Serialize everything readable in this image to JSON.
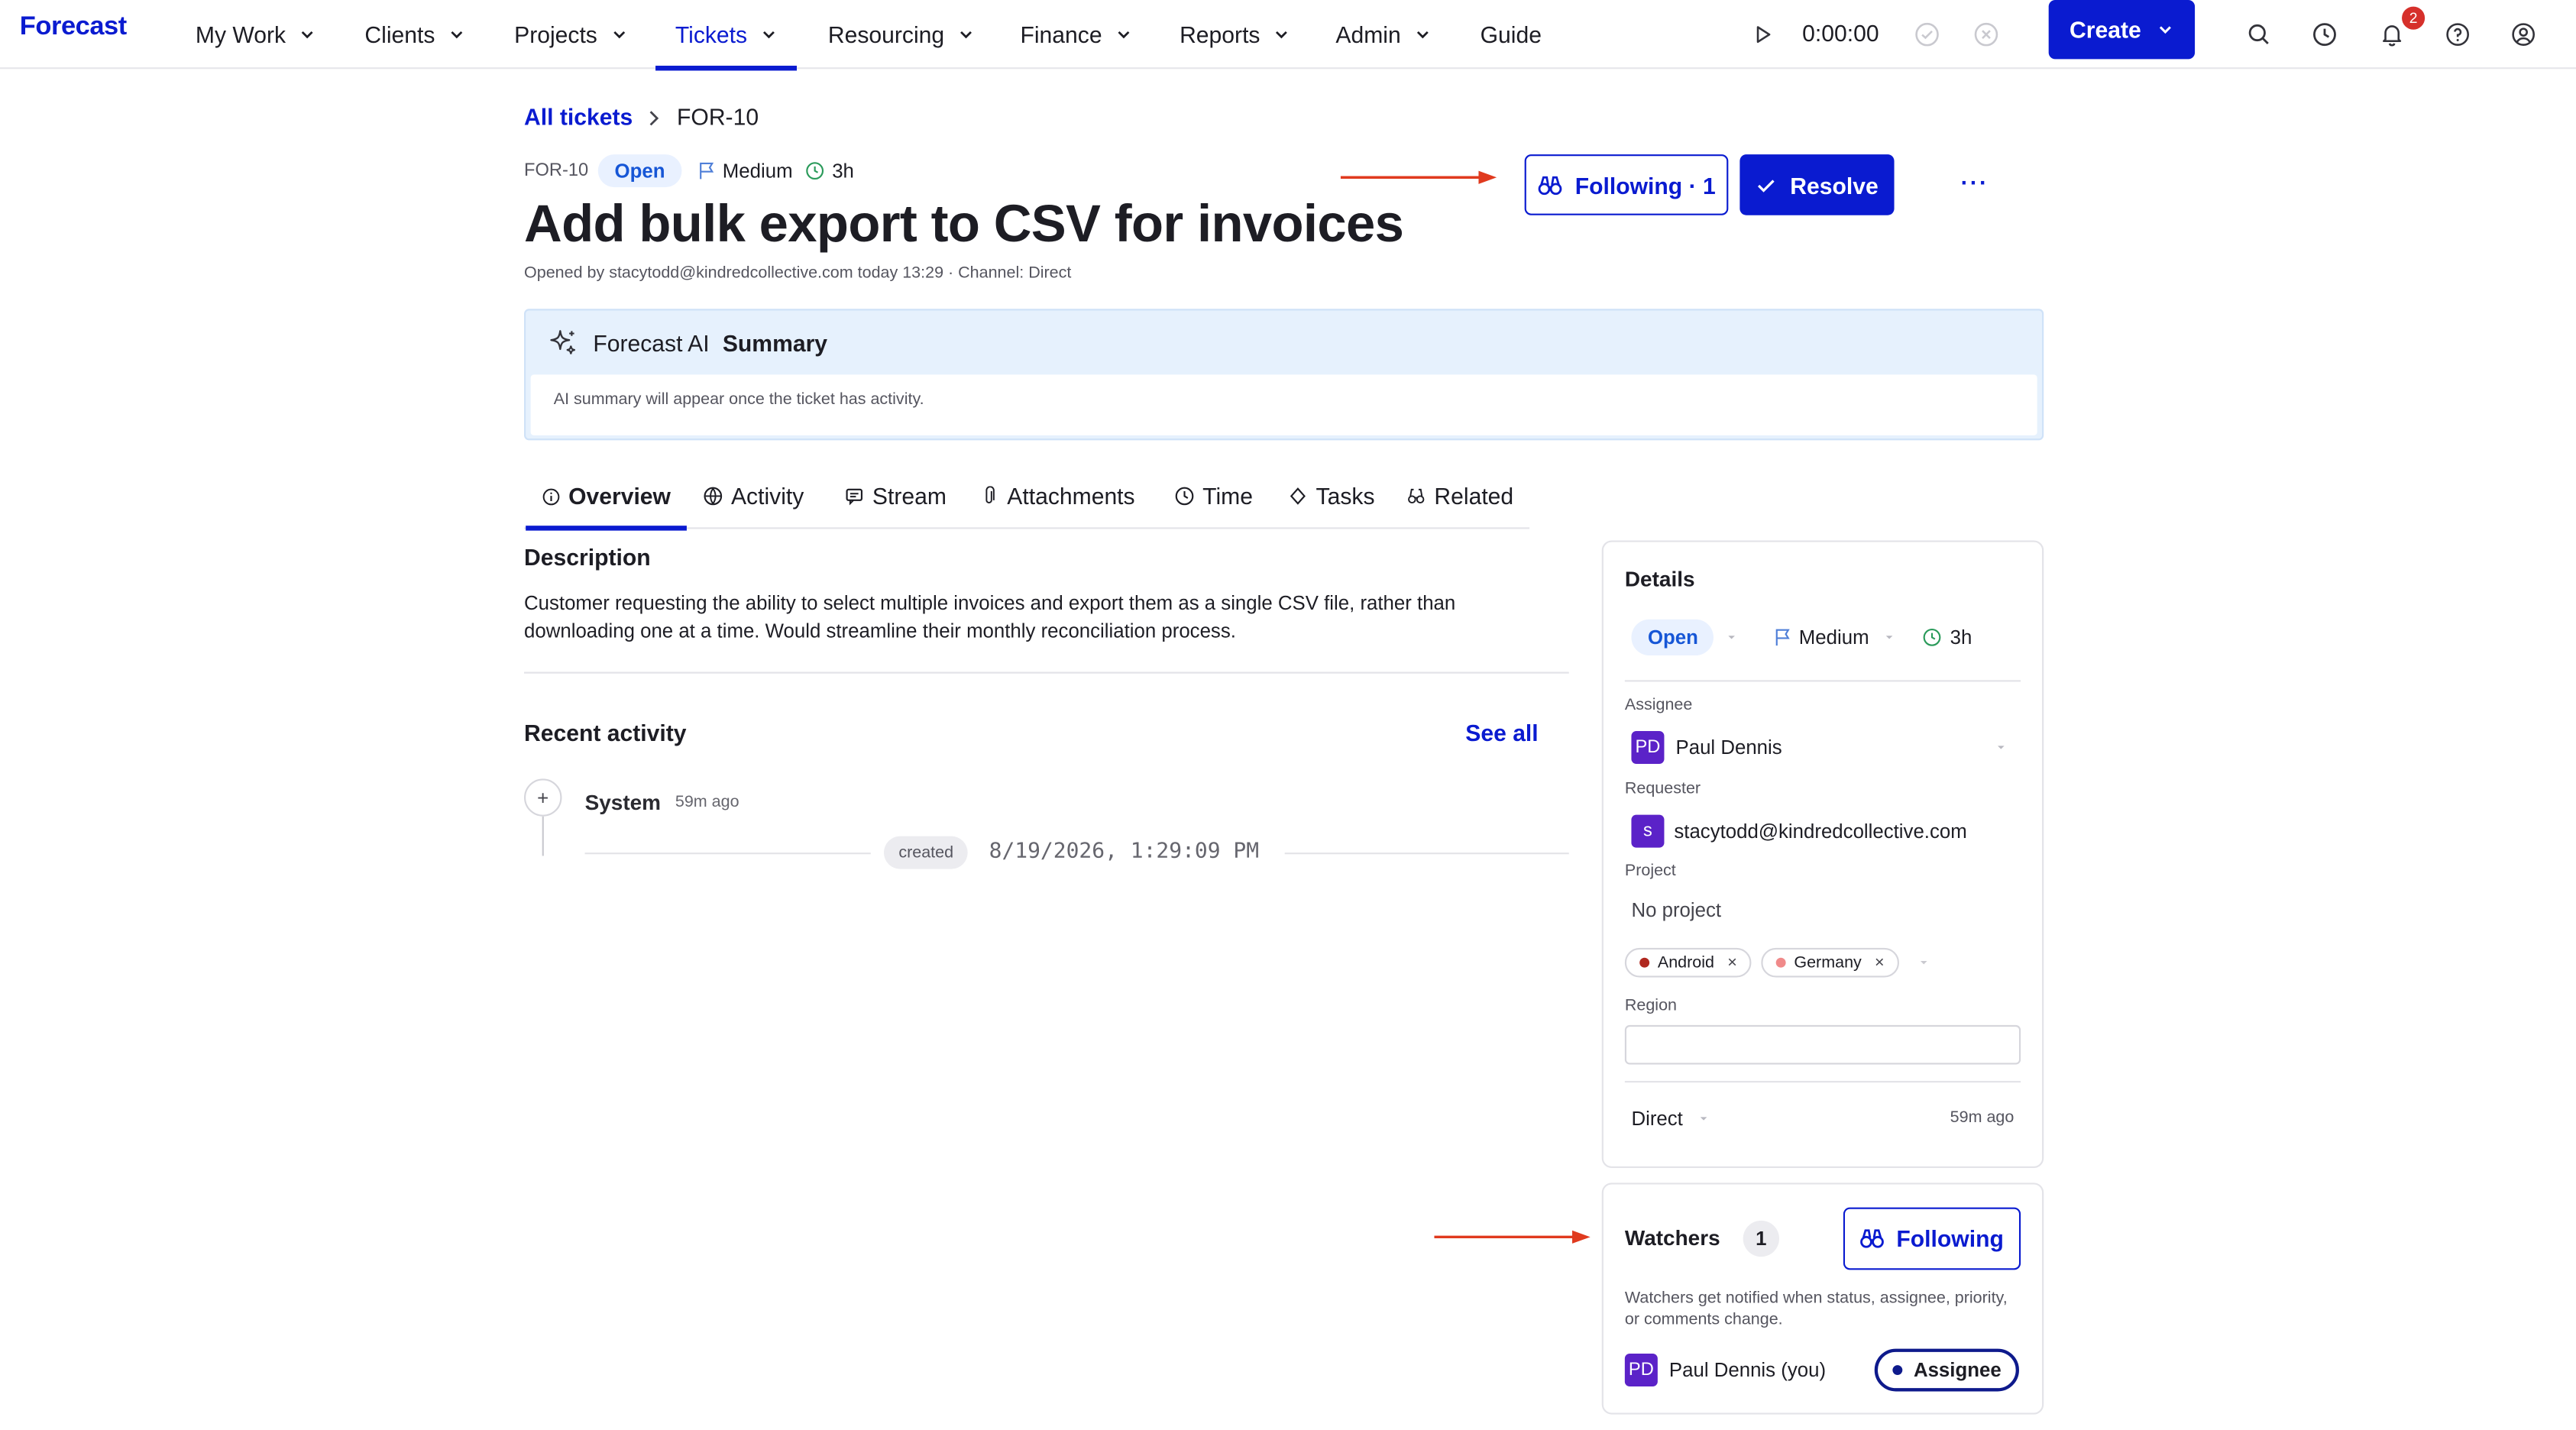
{
  "nav": {
    "brand": "Forecast",
    "items": [
      {
        "label": "My Work"
      },
      {
        "label": "Clients"
      },
      {
        "label": "Projects"
      },
      {
        "label": "Tickets"
      },
      {
        "label": "Resourcing"
      },
      {
        "label": "Finance"
      },
      {
        "label": "Reports"
      },
      {
        "label": "Admin"
      },
      {
        "label": "Guide"
      }
    ],
    "active": "Tickets",
    "timer": "0:00:00",
    "create_label": "Create",
    "notifications_count": "2",
    "icons": [
      "play-icon",
      "check-circle-icon",
      "x-circle-icon",
      "search-icon",
      "clock-icon",
      "bell-icon",
      "help-icon",
      "user-circle-icon"
    ]
  },
  "breadcrumb": {
    "link": "All tickets",
    "current": "FOR-10"
  },
  "ticket": {
    "id": "FOR-10",
    "status": "Open",
    "priority": "Medium",
    "estimate": "3h",
    "title": "Add bulk export to CSV for invoices",
    "opened_by": "Opened by stacytodd@kindredcollective.com today 13:29 · Channel: Direct",
    "following_label": "Following · 1",
    "resolve_label": "Resolve",
    "more_label": "···"
  },
  "ai_summary": {
    "brand": "Forecast AI",
    "title": "Summary",
    "text": "AI summary will appear once the ticket has activity."
  },
  "tabs": [
    {
      "label": "Overview",
      "icon": "info-icon"
    },
    {
      "label": "Activity",
      "icon": "activity-icon"
    },
    {
      "label": "Stream",
      "icon": "stream-icon"
    },
    {
      "label": "Attachments",
      "icon": "paperclip-icon"
    },
    {
      "label": "Time",
      "icon": "clock-icon"
    },
    {
      "label": "Tasks",
      "icon": "diamond-icon"
    },
    {
      "label": "Related",
      "icon": "related-icon"
    }
  ],
  "description": {
    "heading": "Description",
    "text": "Customer requesting the ability to select multiple invoices and export them as a single CSV file, rather than downloading one at a time. Would streamline their monthly reconciliation process."
  },
  "activity": {
    "heading": "Recent activity",
    "see_all": "See all",
    "actor": "System",
    "ago": "59m ago",
    "event": "created",
    "timestamp": "8/19/2026, 1:29:09 PM"
  },
  "details": {
    "heading": "Details",
    "status": "Open",
    "priority": "Medium",
    "estimate": "3h",
    "assignee_label": "Assignee",
    "assignee_initials": "PD",
    "assignee_name": "Paul Dennis",
    "requester_label": "Requester",
    "requester_initial": "s",
    "requester_email": "stacytodd@kindredcollective.com",
    "project_label": "Project",
    "project_value": "No project",
    "tags": [
      {
        "label": "Android",
        "color": "#b0281f"
      },
      {
        "label": "Germany",
        "color": "#f08a8a"
      }
    ],
    "region_label": "Region",
    "channel": "Direct",
    "channel_ago": "59m ago"
  },
  "watchers": {
    "heading": "Watchers",
    "count": "1",
    "following_label": "Following",
    "note": "Watchers get notified when status, assignee, priority, or comments change.",
    "watcher_initials": "PD",
    "watcher_name": "Paul Dennis (you)",
    "role": "Assignee"
  },
  "colors": {
    "accent": "#0a1bd0",
    "annotation_arrow": "#e03a1e",
    "avatar": "#5b22c8",
    "ai_bg": "#e6f1fd"
  }
}
